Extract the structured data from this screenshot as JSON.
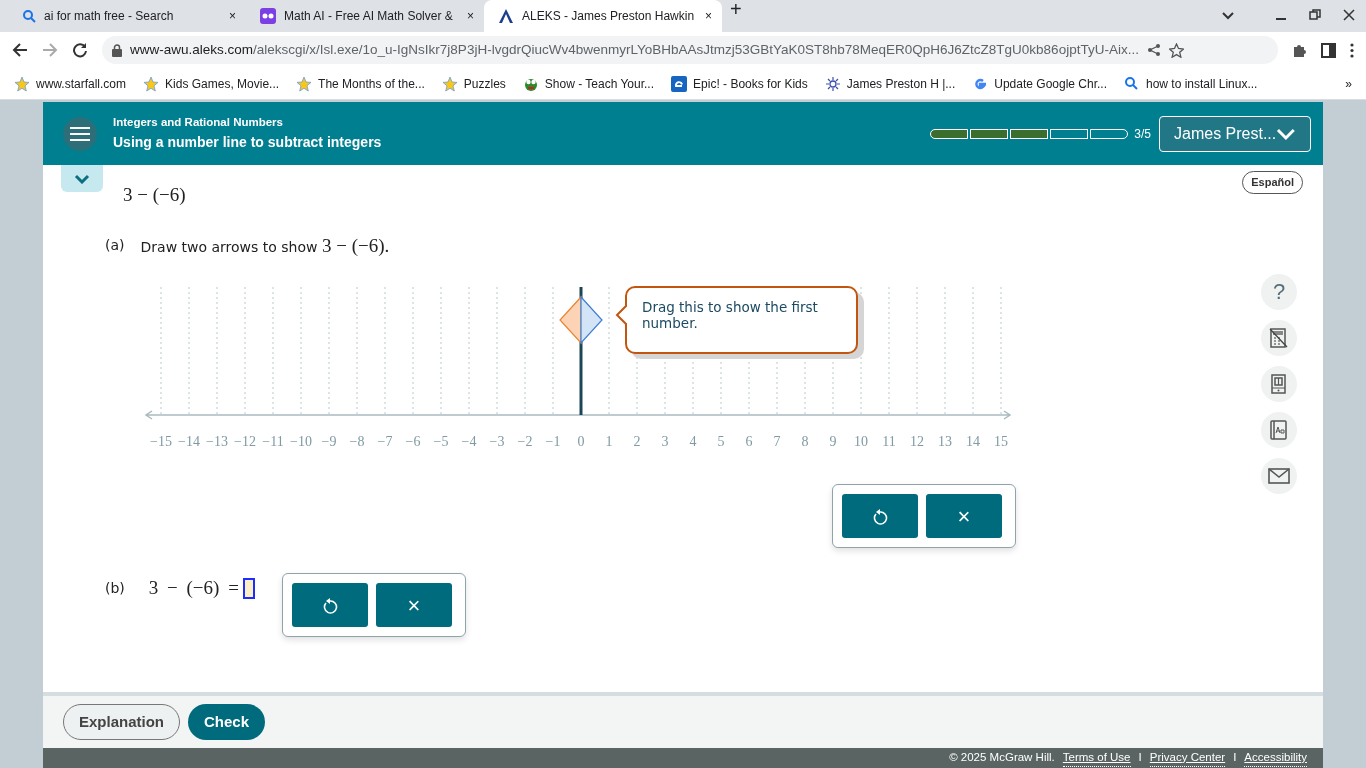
{
  "browser": {
    "tabs": [
      {
        "title": "ai for math free - Search",
        "close": "×",
        "selected": false
      },
      {
        "title": "Math AI - Free AI Math Solver &",
        "close": "×",
        "selected": false
      },
      {
        "title": "ALEKS - James Preston Hawkin",
        "close": "×",
        "selected": true
      }
    ],
    "new_tab": "+",
    "url_host": "www-awu.aleks.com",
    "url_path": "/alekscgi/x/Isl.exe/1o_u-IgNsIkr7j8P3jH-lvgdrQiucWv4bwenmyrLYoBHbAAsJtmzj53GBtYaK0ST8hb78MeqER0QpH6J6ZtcZ8TgU0kb86ojptTyU-Aix...",
    "bookmarks": [
      "www.starfall.com",
      "Kids Games, Movie...",
      "The Months of the...",
      "Puzzles",
      "Show - Teach Your...",
      "Epic! - Books for Kids",
      "James Preston H |...",
      "Update Google Chr...",
      "how to install Linux..."
    ],
    "bookmarks_more": "»"
  },
  "header": {
    "topic": "Integers and Rational Numbers",
    "title": "Using a number line to subtract integers",
    "progress": {
      "segments": [
        {
          "done": true
        },
        {
          "done": true
        },
        {
          "done": true
        },
        {
          "done": false
        },
        {
          "done": false
        }
      ],
      "label": "3/5"
    },
    "user": "James Prest..."
  },
  "language_button": "Español",
  "expression": "3 − (−6)",
  "part_a": {
    "label": "(a)",
    "instruction": "Draw two arrows to show",
    "math": "3 − (−6)."
  },
  "number_line": {
    "labels": [
      "−15",
      "−14",
      "−13",
      "−12",
      "−11",
      "−10",
      "−9",
      "−8",
      "−7",
      "−6",
      "−5",
      "−4",
      "−3",
      "−2",
      "−1",
      "0",
      "1",
      "2",
      "3",
      "4",
      "5",
      "6",
      "7",
      "8",
      "9",
      "10",
      "11",
      "12",
      "13",
      "14",
      "15"
    ],
    "tooltip": [
      "Drag this to show the first",
      "number."
    ]
  },
  "tools": {
    "help": "?"
  },
  "buttons_a": {
    "clear": "×"
  },
  "part_b": {
    "label": "(b)",
    "math": "3 − (−6) =",
    "clear": "×"
  },
  "footer": {
    "explanation": "Explanation",
    "check": "Check",
    "copyright": "© 2025 McGraw Hill.",
    "links": [
      "Terms of Use",
      "Privacy Center",
      "Accessibility"
    ],
    "separators": [
      "I",
      "I"
    ]
  }
}
